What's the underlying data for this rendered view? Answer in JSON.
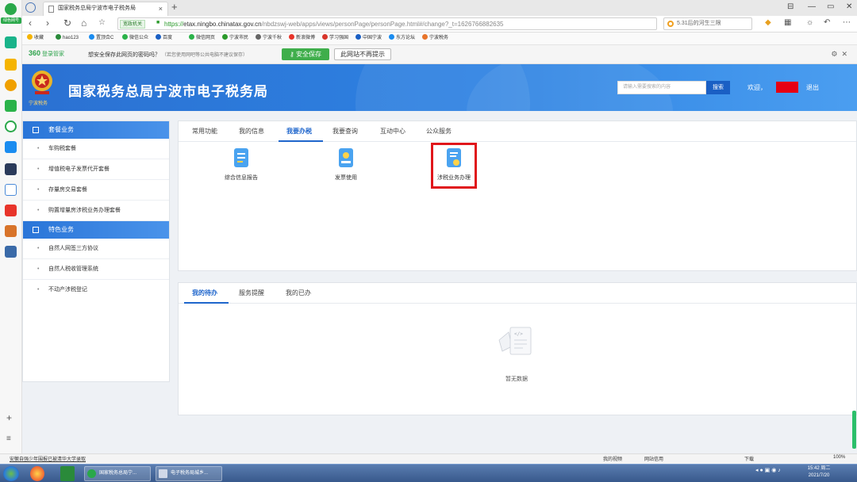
{
  "browser": {
    "tab_title": "国家税务总局宁波市电子税务局",
    "url_badge": "宽政机关",
    "url_proto": "https://",
    "url_host": "etax.ningbo.chinatax.gov.cn",
    "url_path": "/nbdzswj-web/apps/views/personPage/personPage.html#/change?_t=1626766882635",
    "search_text": "5.31后的河生三限",
    "rail_logo": "绿色网号"
  },
  "bookmarks": [
    "收藏",
    "hao123",
    "置顶合C",
    "微信公众",
    "百度",
    "微信网页",
    "宁波市民",
    "宁波千秋",
    "新浪微博",
    "学习强国",
    "中国宁波",
    "东方论坛",
    "宁波税务"
  ],
  "password_bar": {
    "brand": "360",
    "brand_sub": "登录管家",
    "question": "想安全保存此网页的密码吗？",
    "note": "（若您使用网吧等公共电脑不建议保存）",
    "save_label": "安全保存",
    "never_label": "此网站不再提示"
  },
  "header": {
    "title": "国家税务总局宁波市电子税务局",
    "emblem_sub": "宁波税务",
    "search_placeholder": "请输入需要搜索的内容",
    "search_button": "搜索",
    "welcome": "欢迎，",
    "logout": "退出"
  },
  "sidebar": {
    "group1": "套餐业务",
    "group1_items": [
      "车购税套餐",
      "增值税电子发票代开套餐",
      "存量房交易套餐",
      "购置增量房涉税业务办理套餐"
    ],
    "group2": "特色业务",
    "group2_items": [
      "自然人网签三方协议",
      "自然人税收管理系统",
      "不动产涉税登记"
    ]
  },
  "top_tabs": [
    "常用功能",
    "我的信息",
    "我要办税",
    "我要查询",
    "互动中心",
    "公众服务"
  ],
  "services": [
    {
      "label": "综合信息报告"
    },
    {
      "label": "发票使用"
    },
    {
      "label": "涉税业务办理"
    }
  ],
  "bottom_tabs": [
    "我的待办",
    "服务提醒",
    "我的已办"
  ],
  "empty_text": "暂无数据",
  "status": {
    "left": "安徽自强少年围报已被清华大学录取",
    "items": [
      "我的视频",
      "网站信用",
      "下载",
      "100%"
    ]
  },
  "taskbar": {
    "task1": "国家税务总局宁...",
    "task2": "电子税务局城乡...",
    "time": "15:42 周二",
    "date": "2021/7/20"
  },
  "colors": {
    "header_blue": "#2e82e2",
    "active_tab": "#1f66cc",
    "highlight_red": "#e0161b",
    "save_green": "#3fae4b"
  }
}
